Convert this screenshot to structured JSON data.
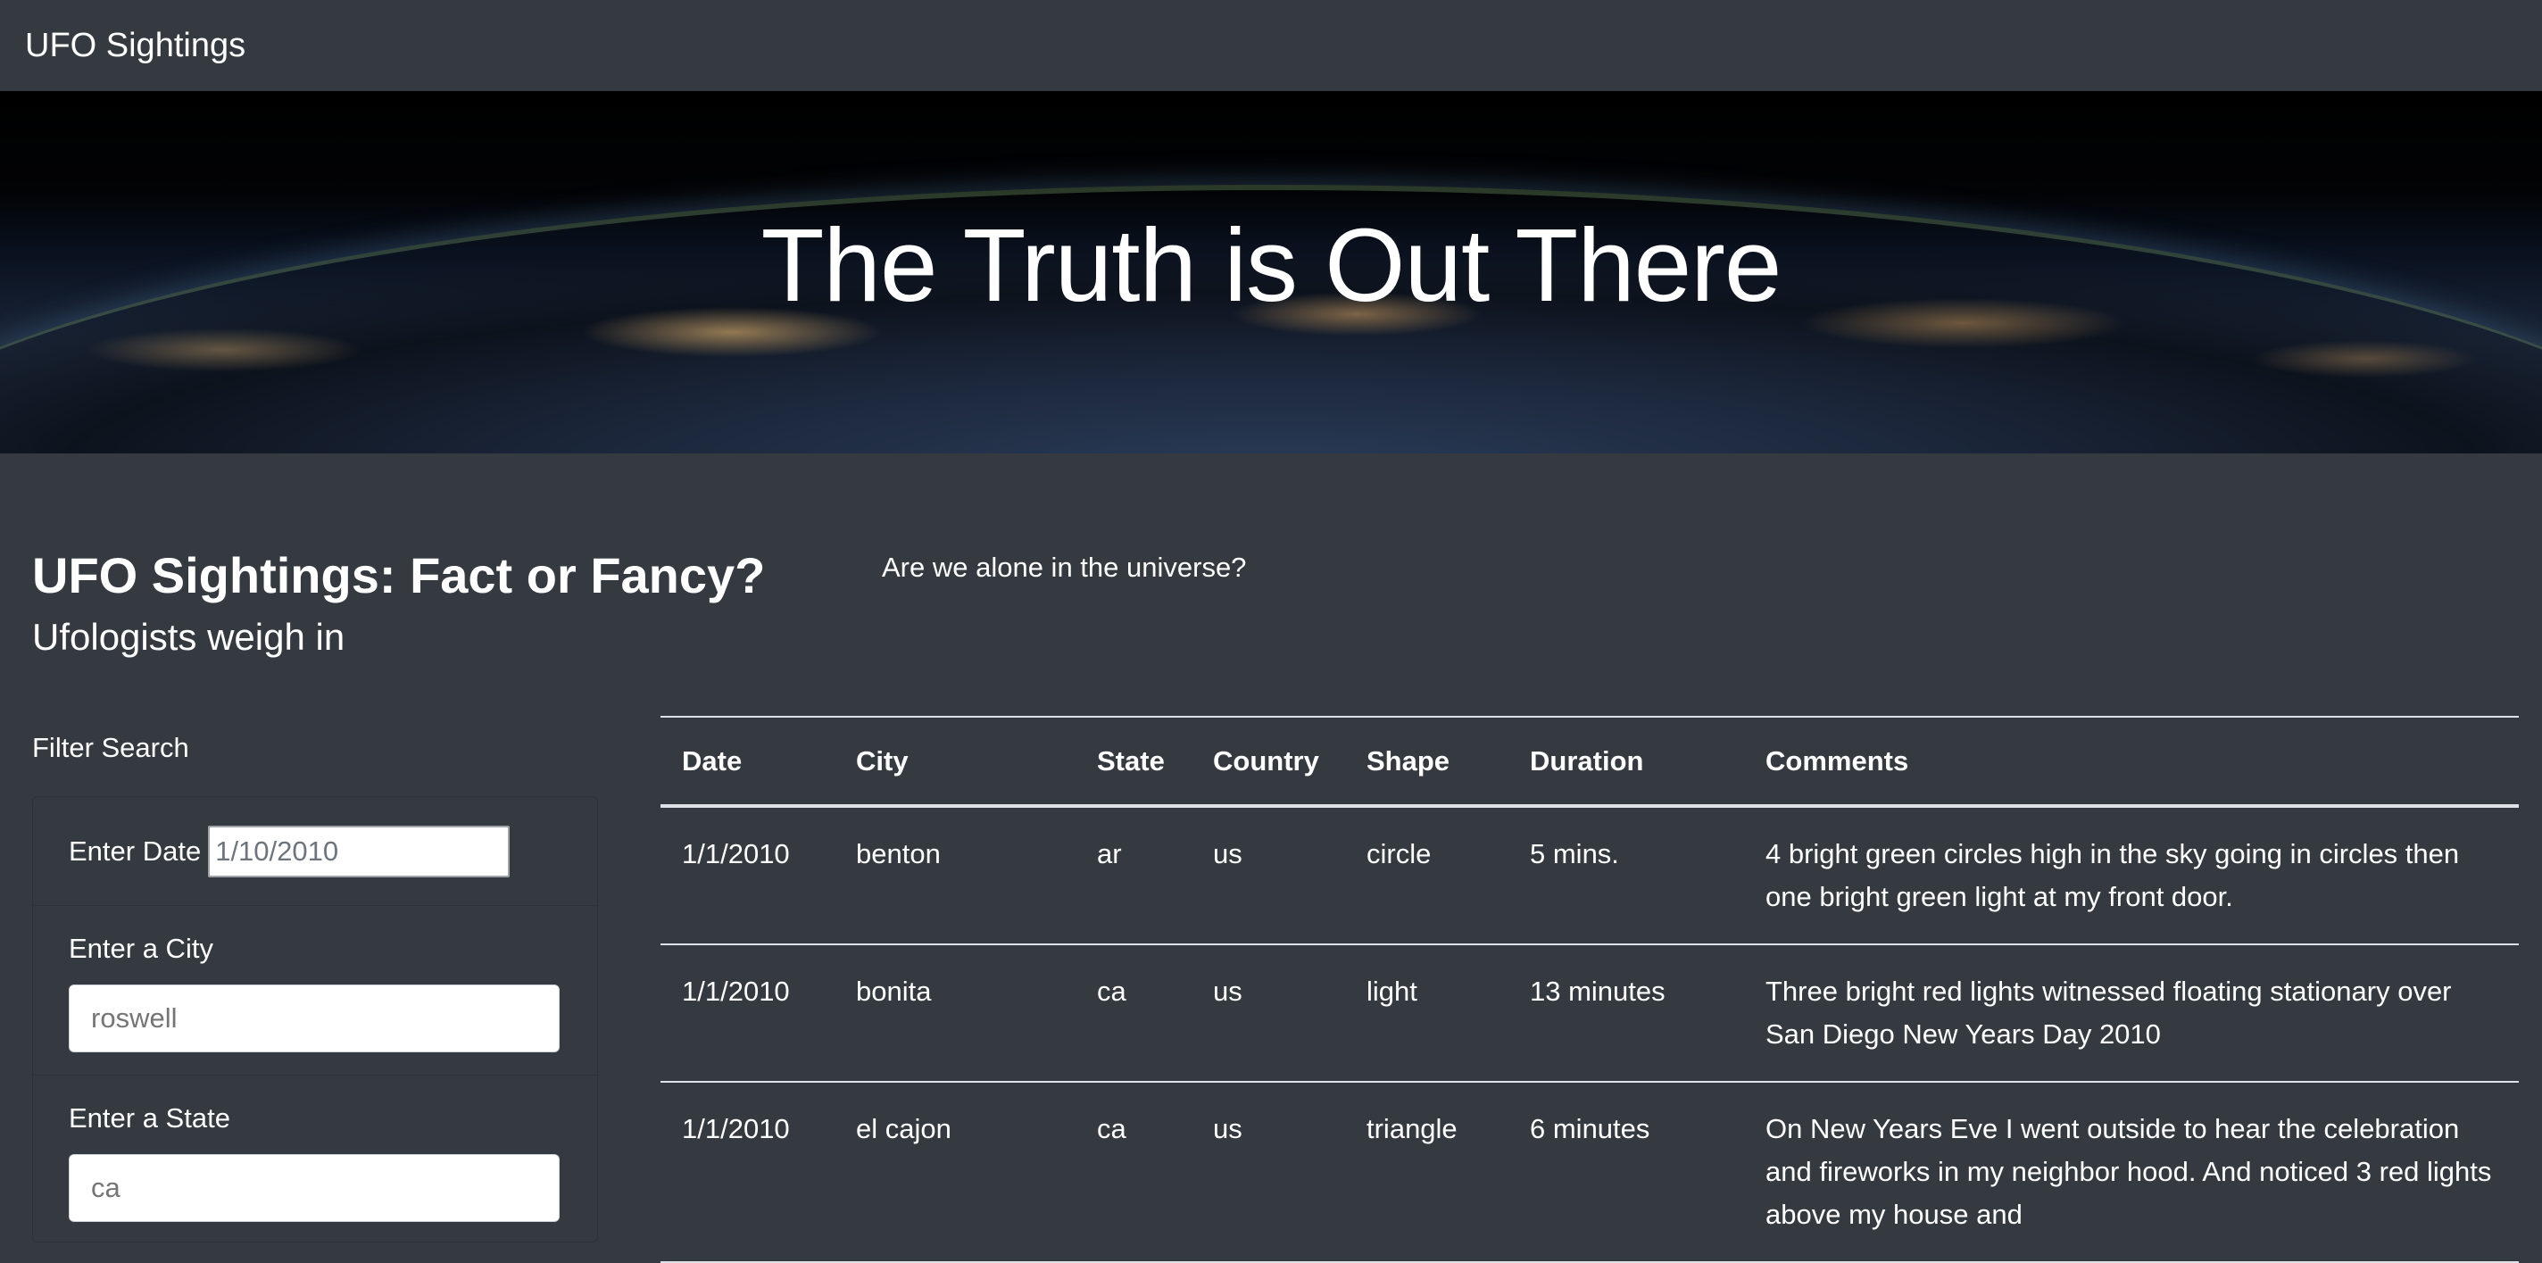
{
  "navbar": {
    "brand": "UFO Sightings"
  },
  "hero": {
    "title": "The Truth is Out There"
  },
  "intro": {
    "heading": "UFO Sightings: Fact or Fancy?",
    "subheading": "Ufologists weigh in",
    "tagline": "Are we alone in the universe?"
  },
  "filters": {
    "title": "Filter Search",
    "date": {
      "label": "Enter Date",
      "value": "1/10/2010"
    },
    "city": {
      "label": "Enter a City",
      "placeholder": "roswell"
    },
    "state": {
      "label": "Enter a State",
      "placeholder": "ca"
    }
  },
  "table": {
    "headers": [
      "Date",
      "City",
      "State",
      "Country",
      "Shape",
      "Duration",
      "Comments"
    ],
    "rows": [
      [
        "1/1/2010",
        "benton",
        "ar",
        "us",
        "circle",
        "5 mins.",
        "4 bright green circles high in the sky going in circles then one bright green light at my front door."
      ],
      [
        "1/1/2010",
        "bonita",
        "ca",
        "us",
        "light",
        "13 minutes",
        "Three bright red lights witnessed floating stationary over San Diego New Years Day 2010"
      ],
      [
        "1/1/2010",
        "el cajon",
        "ca",
        "us",
        "triangle",
        "6 minutes",
        "On New Years Eve I went outside to hear the celebration and fireworks in my neighbor hood. And noticed 3 red lights above my house and"
      ]
    ]
  }
}
